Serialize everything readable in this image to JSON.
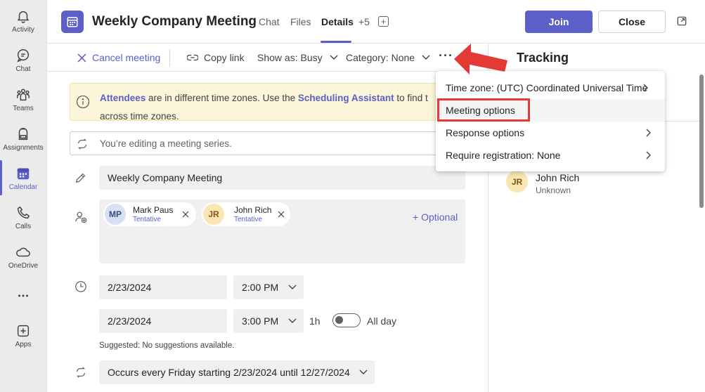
{
  "rail": {
    "items": [
      {
        "label": "Activity",
        "icon": "bell-icon"
      },
      {
        "label": "Chat",
        "icon": "chat-icon"
      },
      {
        "label": "Teams",
        "icon": "teams-icon"
      },
      {
        "label": "Assignments",
        "icon": "backpack-icon"
      },
      {
        "label": "Calendar",
        "icon": "calendar-icon",
        "active": true
      },
      {
        "label": "Calls",
        "icon": "phone-icon"
      },
      {
        "label": "OneDrive",
        "icon": "cloud-icon"
      },
      {
        "label": "",
        "icon": "more-icon"
      },
      {
        "label": "Apps",
        "icon": "apps-icon"
      }
    ]
  },
  "header": {
    "title": "Weekly Company Meeting",
    "tabs": [
      "Chat",
      "Files",
      "Details",
      "+5"
    ],
    "active_tab": "Details",
    "join_label": "Join",
    "close_label": "Close"
  },
  "toolbar": {
    "cancel_label": "Cancel meeting",
    "copy_link_label": "Copy link",
    "show_as_label": "Show as: Busy",
    "category_label": "Category: None",
    "more_label": "···"
  },
  "banner": {
    "link1": "Attendees",
    "text1": " are in different time zones. Use the ",
    "link2": "Scheduling Assistant",
    "text2": " to find t",
    "line2": "across time zones."
  },
  "series_notice": "You’re editing a meeting series.",
  "meeting_title_value": "Weekly Company Meeting",
  "attendees": [
    {
      "initials": "MP",
      "name": "Mark Paus",
      "status": "Tentative",
      "avatar_bg": "#d6e1f5",
      "avatar_fg": "#3b4a7a"
    },
    {
      "initials": "JR",
      "name": "John Rich",
      "status": "Tentative",
      "avatar_bg": "#fbe6b3",
      "avatar_fg": "#7a5a12"
    }
  ],
  "optional_label": "+ Optional",
  "start": {
    "date": "2/23/2024",
    "time": "2:00 PM"
  },
  "end": {
    "date": "2/23/2024",
    "time": "3:00 PM",
    "duration": "1h"
  },
  "all_day_label": "All day",
  "all_day_on": false,
  "suggestion_hint": "Suggested: No suggestions available.",
  "recurrence_label": "Occurs every Friday starting 2/23/2024 until 12/27/2024",
  "tracking": {
    "title": "Tracking",
    "attendee": {
      "initials": "JR",
      "name": "John Rich",
      "status": "Unknown"
    }
  },
  "menu": {
    "items": [
      {
        "label": "Time zone: (UTC) Coordinated Universal Time",
        "submenu": true
      },
      {
        "label": "Meeting options",
        "submenu": false,
        "highlighted": true
      },
      {
        "label": "Response options",
        "submenu": true
      },
      {
        "label": "Require registration: None",
        "submenu": true
      }
    ]
  },
  "colors": {
    "accent": "#5b5fc7",
    "annotation": "#e53935",
    "banner_bg": "#fbf6d9"
  }
}
